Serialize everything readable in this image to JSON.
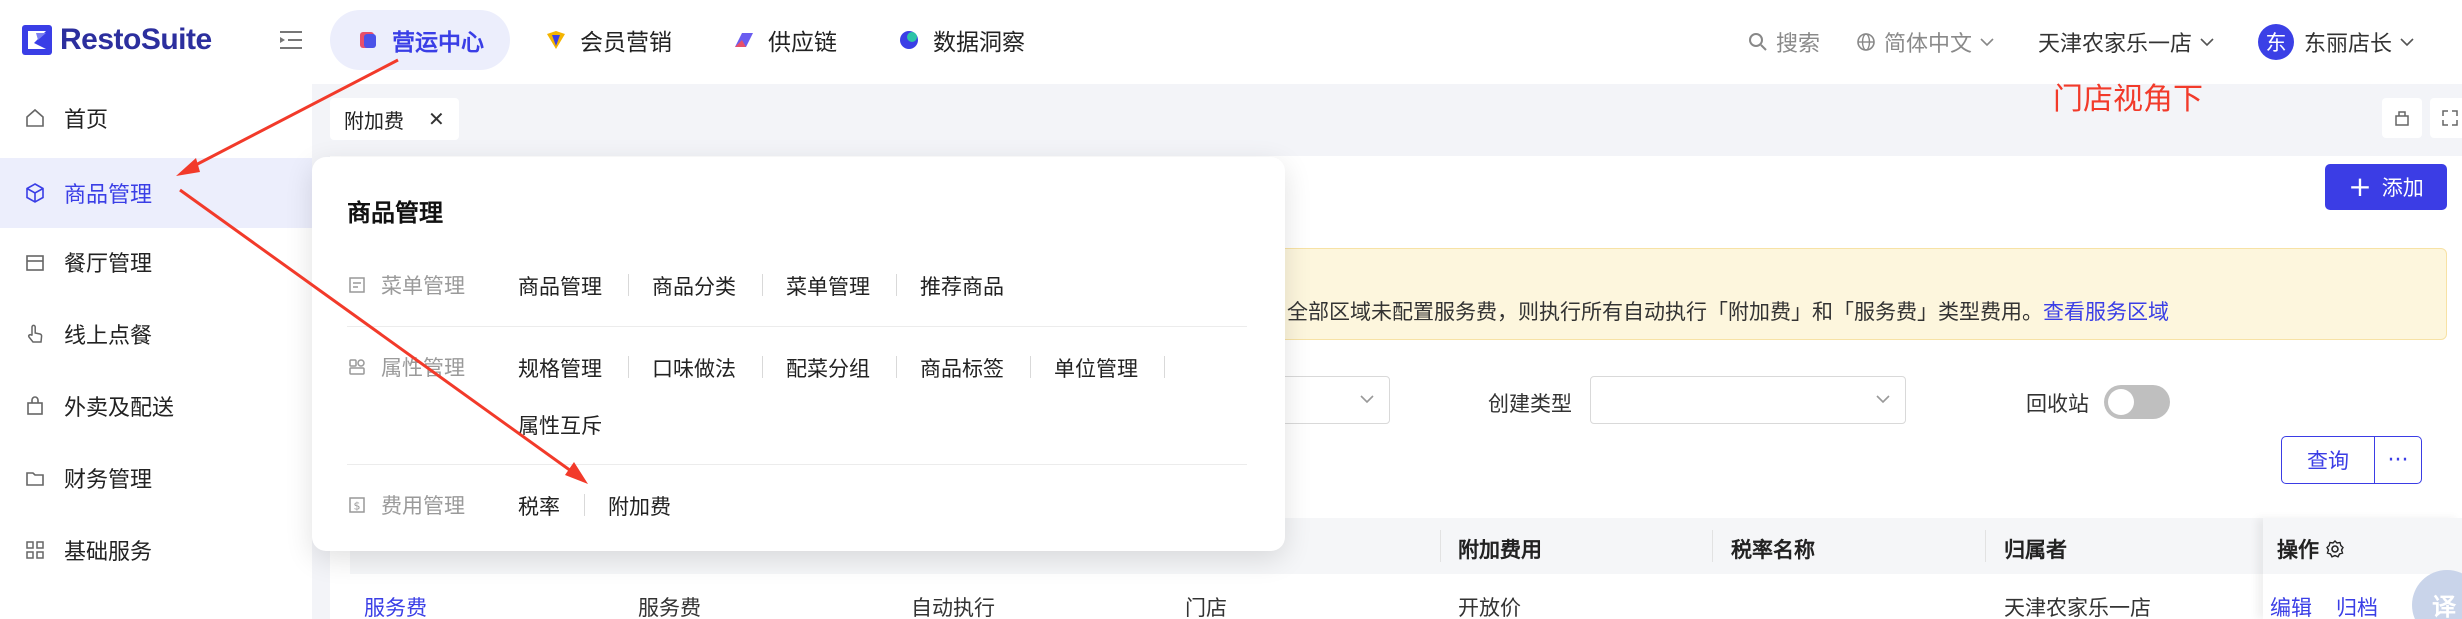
{
  "brand": {
    "name": "RestoSuite"
  },
  "topnav": {
    "items": [
      {
        "label": "营运中心",
        "icon": "operations-icon",
        "active": true
      },
      {
        "label": "会员营销",
        "icon": "member-marketing-icon",
        "active": false
      },
      {
        "label": "供应链",
        "icon": "supply-chain-icon",
        "active": false
      },
      {
        "label": "数据洞察",
        "icon": "data-insight-icon",
        "active": false
      }
    ],
    "search_label": "搜索",
    "language_label": "简体中文",
    "store_label": "天津农家乐一店",
    "user_avatar_text": "东",
    "user_label": "东丽店长"
  },
  "sidebar": {
    "items": [
      {
        "label": "首页",
        "icon": "home-icon"
      },
      {
        "label": "商品管理",
        "icon": "cube-icon",
        "active": true
      },
      {
        "label": "餐厅管理",
        "icon": "restaurant-icon"
      },
      {
        "label": "线上点餐",
        "icon": "hand-tap-icon"
      },
      {
        "label": "外卖及配送",
        "icon": "bag-icon"
      },
      {
        "label": "财务管理",
        "icon": "folder-icon"
      },
      {
        "label": "基础服务",
        "icon": "grid-icon"
      }
    ]
  },
  "tabs": {
    "current": "附加费"
  },
  "annotation": "门店视角下",
  "toolbar": {
    "add_label": "添加"
  },
  "alert": {
    "text": "全部区域未配置服务费，则执行所有自动执行「附加费」和「服务费」类型费用。",
    "link": "查看服务区域"
  },
  "filters": {
    "create_type_label": "创建类型",
    "recycle_label": "回收站",
    "query_label": "查询",
    "more_label": "···"
  },
  "table": {
    "headers": [
      "附加费用",
      "税率名称",
      "归属者",
      "操作"
    ],
    "row": {
      "name": "服务费",
      "type": "服务费",
      "scene": "自动执行",
      "create_type": "门店",
      "fee": "开放价",
      "tax": "",
      "owner": "天津农家乐一店",
      "action_edit": "编辑",
      "action_archive": "归档"
    }
  },
  "menu": {
    "title": "商品管理",
    "groups": [
      {
        "label": "菜单管理",
        "icon": "menu-doc-icon",
        "links": [
          "商品管理",
          "商品分类",
          "菜单管理",
          "推荐商品"
        ]
      },
      {
        "label": "属性管理",
        "icon": "attribute-icon",
        "links": [
          "规格管理",
          "口味做法",
          "配菜分组",
          "商品标签",
          "单位管理",
          "属性互斥"
        ]
      },
      {
        "label": "费用管理",
        "icon": "fee-icon",
        "links": [
          "税率",
          "附加费"
        ]
      }
    ]
  },
  "translate_fab": "译",
  "colors": {
    "accent": "#3b3de5",
    "annotation": "#f23a2a",
    "alert_bg": "#fdf6dd"
  }
}
